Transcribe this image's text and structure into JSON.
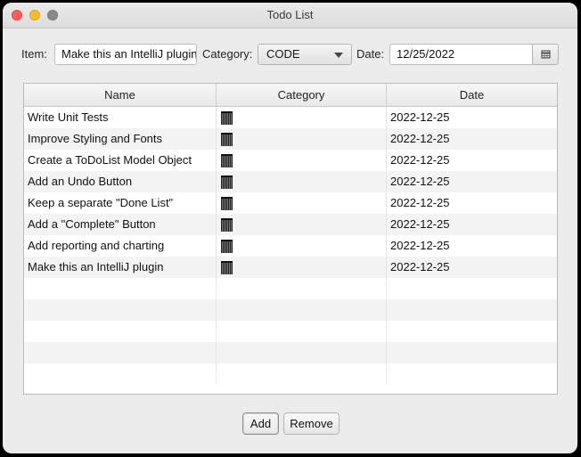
{
  "window": {
    "title": "Todo List"
  },
  "form": {
    "item_label": "Item:",
    "item_value": "Make this an IntelliJ plugin",
    "category_label": "Category:",
    "category_value": "CODE",
    "date_label": "Date:",
    "date_value": "12/25/2022"
  },
  "table": {
    "columns": [
      "Name",
      "Category",
      "Date"
    ],
    "rows": [
      {
        "name": "Write Unit Tests",
        "date": "2022-12-25"
      },
      {
        "name": "Improve Styling and Fonts",
        "date": "2022-12-25"
      },
      {
        "name": "Create a ToDoList Model Object",
        "date": "2022-12-25"
      },
      {
        "name": "Add an Undo Button",
        "date": "2022-12-25"
      },
      {
        "name": "Keep a separate \"Done List\"",
        "date": "2022-12-25"
      },
      {
        "name": "Add a \"Complete\" Button",
        "date": "2022-12-25"
      },
      {
        "name": "Add reporting and charting",
        "date": "2022-12-25"
      },
      {
        "name": "Make this an IntelliJ plugin",
        "date": "2022-12-25"
      }
    ],
    "empty_rows": 5
  },
  "buttons": {
    "add": "Add",
    "remove": "Remove"
  }
}
